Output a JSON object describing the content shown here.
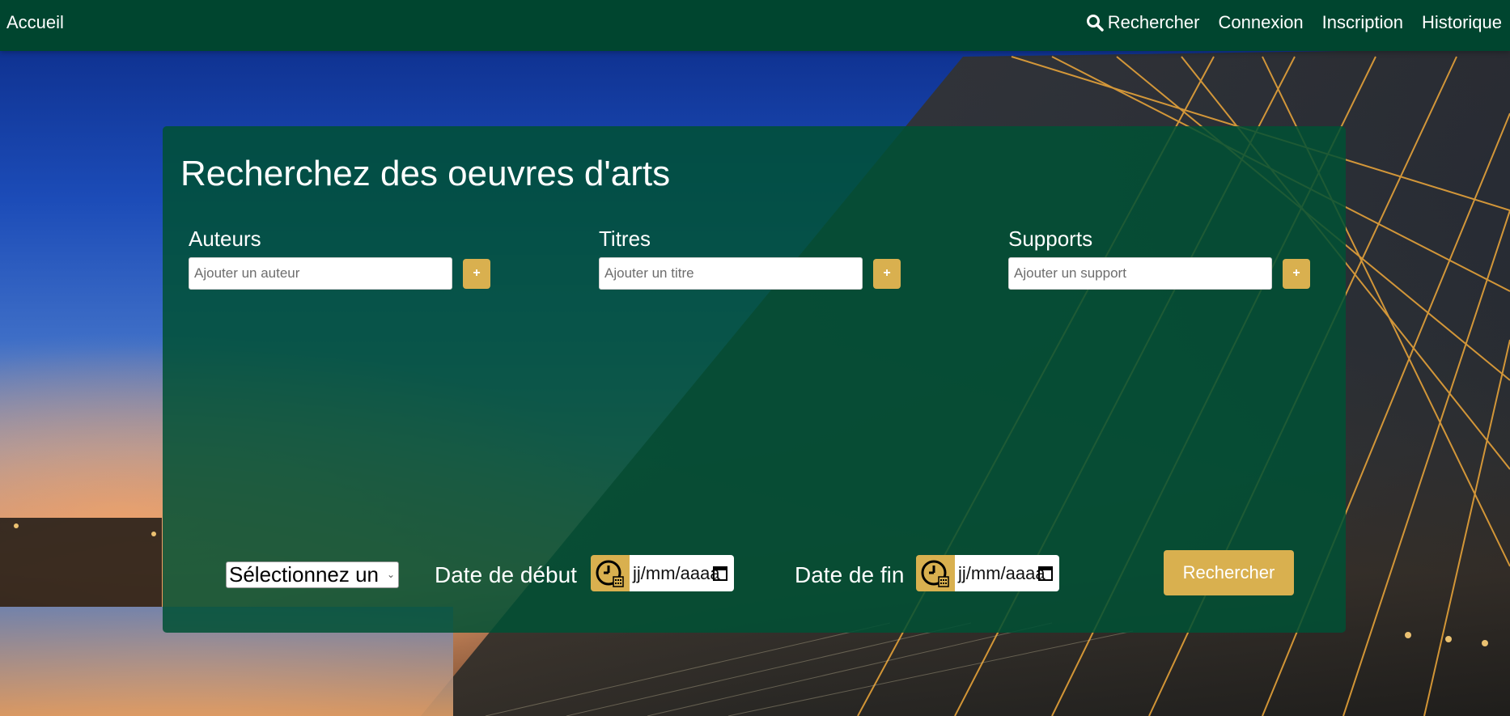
{
  "nav": {
    "home": "Accueil",
    "search": "Rechercher",
    "login": "Connexion",
    "signup": "Inscription",
    "history": "Historique"
  },
  "search_panel": {
    "title": "Recherchez des oeuvres d'arts",
    "fields": [
      {
        "label": "Auteurs",
        "placeholder": "Ajouter un auteur",
        "add": "+"
      },
      {
        "label": "Titres",
        "placeholder": "Ajouter un titre",
        "add": "+"
      },
      {
        "label": "Supports",
        "placeholder": "Ajouter un support",
        "add": "+"
      }
    ],
    "select": {
      "value": "Sélectionnez un"
    },
    "start_date": {
      "label": "Date de début",
      "placeholder": "jj/mm/aaaa"
    },
    "end_date": {
      "label": "Date de fin",
      "placeholder": "jj/mm/aaaa"
    },
    "submit": "Rechercher"
  },
  "colors": {
    "navbar": "#00452f",
    "panel": "#005034",
    "accent": "#d9b04f"
  },
  "icons": [
    "search-icon",
    "clock-calendar-icon",
    "calendar-icon"
  ]
}
